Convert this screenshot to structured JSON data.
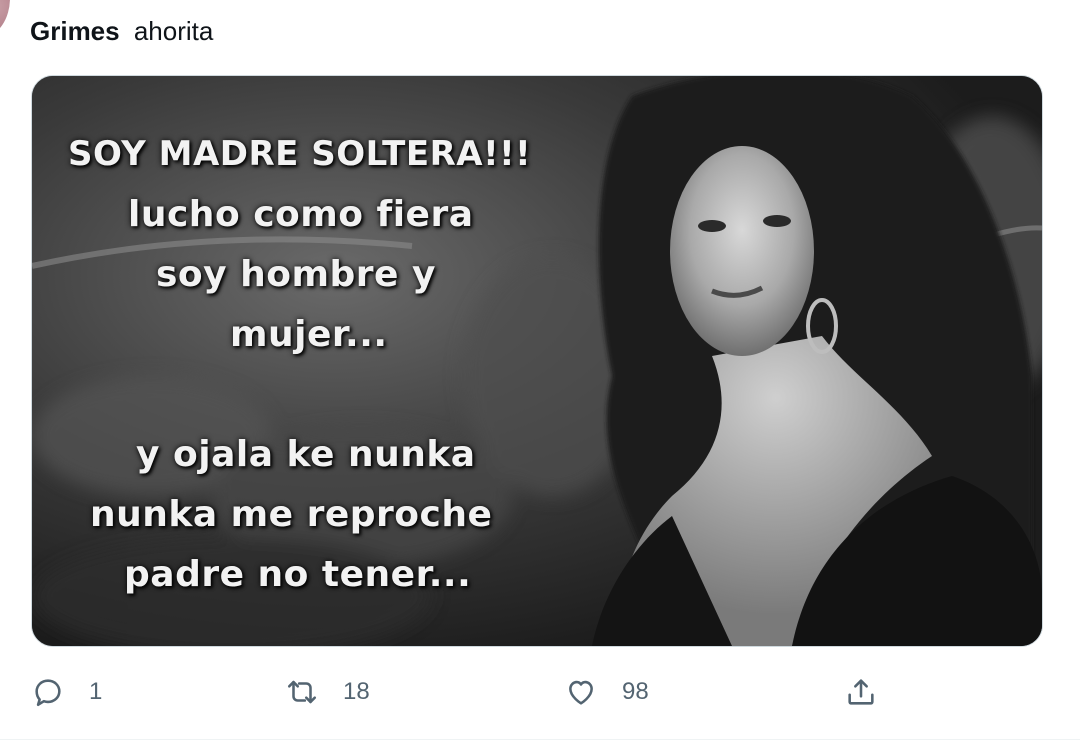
{
  "tweet": {
    "author_name": "Grimes",
    "time": "ahorita",
    "media": {
      "alt": "meme",
      "lines": [
        "SOY MADRE SOLTERA!!!",
        "lucho como fiera",
        "soy hombre y",
        "mujer...",
        "y ojala ke nunka",
        "nunka me reproche",
        "padre no tener..."
      ]
    },
    "actions": {
      "reply": {
        "icon": "reply-icon",
        "count": "1"
      },
      "retweet": {
        "icon": "retweet-icon",
        "count": "18"
      },
      "like": {
        "icon": "heart-icon",
        "count": "98"
      },
      "share": {
        "icon": "share-icon"
      }
    },
    "colors": {
      "text": "#0f1419",
      "action_gray": "#536471",
      "border": "#cfd9de"
    }
  }
}
